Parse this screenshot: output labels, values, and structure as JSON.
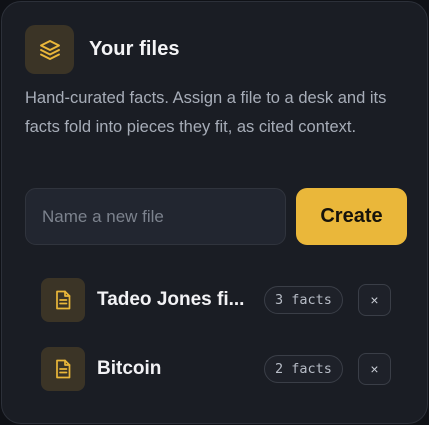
{
  "panel": {
    "title": "Your files",
    "description": "Hand-curated facts. Assign a file to a desk and its facts fold into pieces they fit, as cited context.",
    "header_icon": "layers-icon",
    "accent_color": "#eab73a"
  },
  "new_file": {
    "placeholder": "Name a new file",
    "value": "",
    "create_label": "Create"
  },
  "files": [
    {
      "name": "Tadeo Jones fi...",
      "facts_label": "3 facts",
      "icon": "document-icon",
      "remove_label": "×"
    },
    {
      "name": "Bitcoin",
      "facts_label": "2 facts",
      "icon": "document-icon",
      "remove_label": "×"
    }
  ]
}
